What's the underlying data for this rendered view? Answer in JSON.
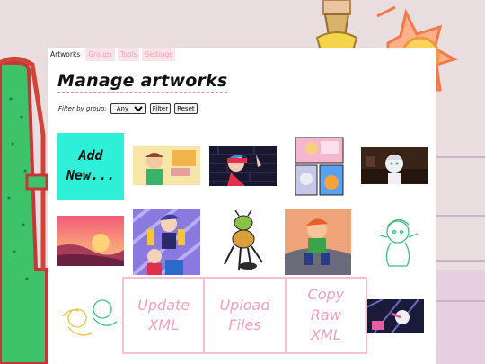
{
  "tabs": [
    {
      "label": "Artworks",
      "active": true
    },
    {
      "label": "Groups",
      "active": false
    },
    {
      "label": "Tools",
      "active": false
    },
    {
      "label": "Settings",
      "active": false
    }
  ],
  "page_title": "Manage artworks",
  "filter": {
    "label": "Filter by group:",
    "selected": "Any",
    "filter_button": "Filter",
    "reset_button": "Reset"
  },
  "add_new_label": "Add\nNew...",
  "artworks": [
    {
      "icon": "boy-with-sign-thumbnail"
    },
    {
      "icon": "girl-with-brick-wall-thumbnail"
    },
    {
      "icon": "comic-strip-thumbnail"
    },
    {
      "icon": "white-haired-girl-thumbnail"
    },
    {
      "icon": "sunset-landscape-thumbnail"
    },
    {
      "icon": "duo-poster-thumbnail"
    },
    {
      "icon": "robot-creature-thumbnail"
    },
    {
      "icon": "boy-on-rock-thumbnail"
    },
    {
      "icon": "green-sketch-thumbnail"
    },
    {
      "icon": "yellow-sketch-thumbnail"
    },
    {
      "icon": "dark-stage-thumbnail"
    }
  ],
  "actions": {
    "update_xml": "Update\nXML",
    "upload_files": "Upload\nFiles",
    "copy_raw_xml": "Copy\nRaw\nXML"
  },
  "colors": {
    "accent_cyan": "#2ef0d8",
    "tab_pink": "#fbe3ea",
    "action_pink": "#f0a0bc"
  }
}
